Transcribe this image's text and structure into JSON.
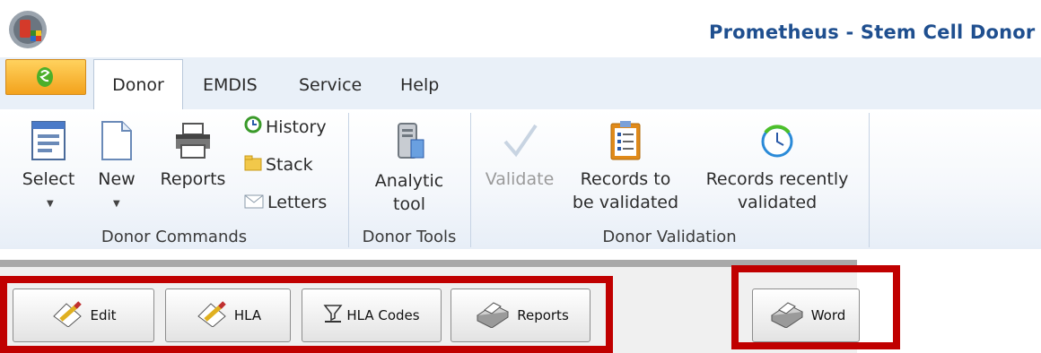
{
  "window": {
    "title": "Prometheus - Stem Cell Donor I"
  },
  "tabs": [
    {
      "label": "Donor",
      "active": true
    },
    {
      "label": "EMDIS",
      "active": false
    },
    {
      "label": "Service",
      "active": false
    },
    {
      "label": "Help",
      "active": false
    }
  ],
  "ribbon": {
    "donor_commands": {
      "label": "Donor Commands",
      "select": "Select",
      "new": "New",
      "reports": "Reports",
      "history": "History",
      "stack": "Stack",
      "letters": "Letters"
    },
    "donor_tools": {
      "label": "Donor Tools",
      "analytic_line1": "Analytic",
      "analytic_line2": "tool"
    },
    "donor_validation": {
      "label": "Donor Validation",
      "validate": "Validate",
      "records_tbv_line1": "Records to",
      "records_tbv_line2": "be validated",
      "records_rv_line1": "Records recently",
      "records_rv_line2": "validated"
    }
  },
  "toolbar": {
    "edit": "Edit",
    "hla": "HLA",
    "hla_codes": "HLA Codes",
    "reports": "Reports",
    "word": "Word"
  },
  "colors": {
    "title": "#1f4f8f",
    "highlight": "#c00000",
    "app_menu": "#f3a21c"
  }
}
